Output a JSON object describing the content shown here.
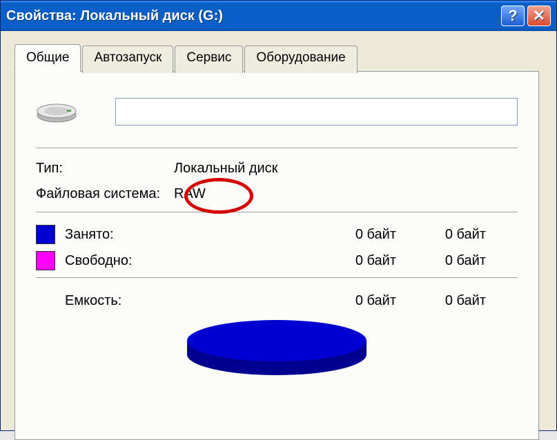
{
  "window": {
    "title": "Свойства: Локальный диск (G:)"
  },
  "tabs": [
    {
      "label": "Общие",
      "active": true
    },
    {
      "label": "Автозапуск",
      "active": false
    },
    {
      "label": "Сервис",
      "active": false
    },
    {
      "label": "Оборудование",
      "active": false
    }
  ],
  "disk": {
    "label_value": "",
    "type_label": "Тип:",
    "type_value": "Локальный диск",
    "fs_label": "Файловая система:",
    "fs_value": "RAW"
  },
  "usage": {
    "used_label": "Занято:",
    "used_bytes": "0 байт",
    "used_short": "0 байт",
    "free_label": "Свободно:",
    "free_bytes": "0 байт",
    "free_short": "0 байт",
    "capacity_label": "Емкость:",
    "capacity_bytes": "0 байт",
    "capacity_short": "0 байт"
  },
  "colors": {
    "used": "#0000d0",
    "free": "#ff00ff"
  }
}
